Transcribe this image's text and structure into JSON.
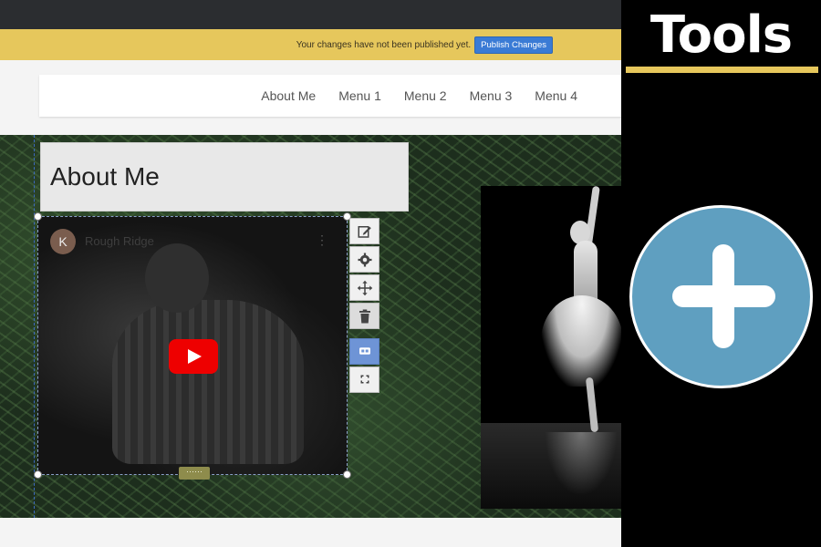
{
  "editor": {
    "notice": {
      "text": "Your changes have not been published yet.",
      "publish_label": "Publish Changes"
    },
    "nav": {
      "items": [
        "About Me",
        "Menu 1",
        "Menu 2",
        "Menu 3",
        "Menu 4"
      ]
    },
    "section_title": "About Me",
    "video": {
      "avatar_letter": "K",
      "channel_name": "Rough Ridge",
      "more_glyph": "⋮",
      "resize_glyph": "⋯⋯"
    },
    "toolbar": {
      "tools": [
        "edit",
        "settings",
        "move",
        "delete",
        "captions",
        "fullscreen"
      ]
    }
  },
  "tools_panel": {
    "title": "Tools",
    "accent_color": "#e6c75c",
    "add_button_color": "#5f9fc0"
  }
}
